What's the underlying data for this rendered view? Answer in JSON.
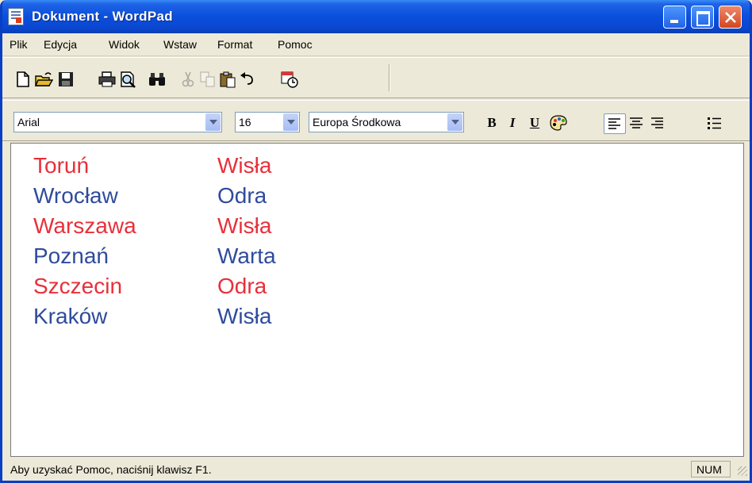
{
  "window": {
    "title": "Dokument - WordPad"
  },
  "menu": [
    {
      "label": "Plik"
    },
    {
      "label": "Edycja"
    },
    {
      "label": "Widok"
    },
    {
      "label": "Wstaw"
    },
    {
      "label": "Format"
    },
    {
      "label": "Pomoc"
    }
  ],
  "format": {
    "font": "Arial",
    "size": "16",
    "script": "Europa Środkowa",
    "bold_label": "B",
    "italic_label": "I",
    "underline_label": "U"
  },
  "content": {
    "rows": [
      {
        "city": "Toruń",
        "river": "Wisła",
        "color": "#e8303a"
      },
      {
        "city": "Wrocław",
        "river": "Odra",
        "color": "#2f4b9c"
      },
      {
        "city": "Warszawa",
        "river": "Wisła",
        "color": "#e8303a"
      },
      {
        "city": "Poznań",
        "river": "Warta",
        "color": "#2f4b9c"
      },
      {
        "city": "Szczecin",
        "river": "Odra",
        "color": "#e8303a"
      },
      {
        "city": "Kraków",
        "river": "Wisła",
        "color": "#2f4b9c"
      }
    ]
  },
  "status": {
    "help": "Aby uzyskać Pomoc, naciśnij klawisz F1.",
    "num": "NUM"
  },
  "colors": {
    "title_bar": "#0a4fdc",
    "face": "#ece9d8",
    "red_text": "#e8303a",
    "blue_text": "#2f4b9c"
  }
}
